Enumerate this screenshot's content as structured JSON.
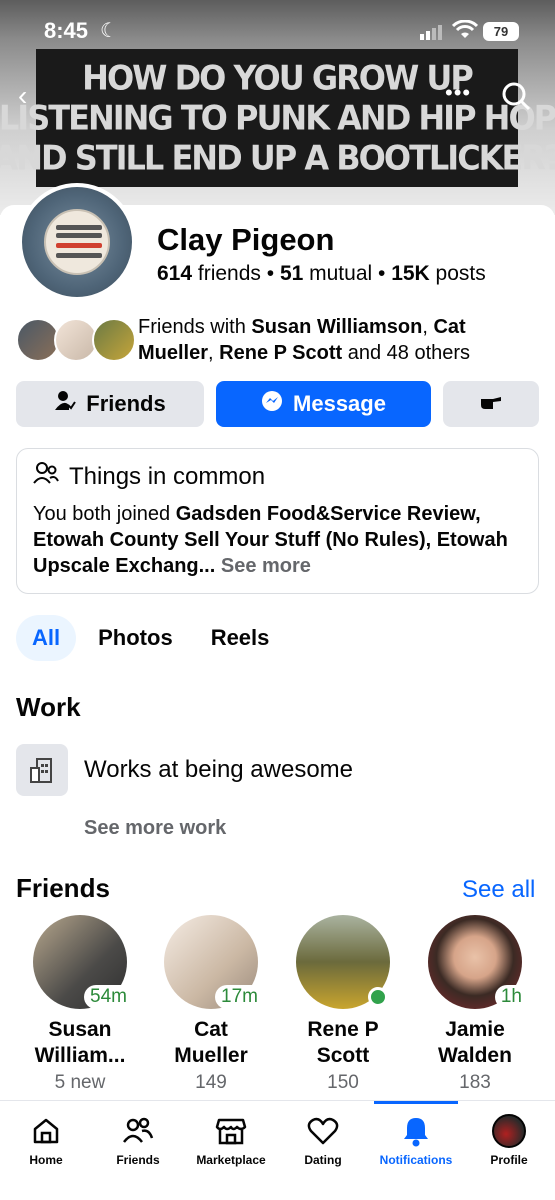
{
  "status_bar": {
    "time": "8:45",
    "battery": "79"
  },
  "cover": {
    "lines": [
      "HOW DO YOU GROW UP",
      "LISTENING TO PUNK AND HIP HOP",
      "AND STILL END UP A BOOTLICKER?"
    ]
  },
  "profile": {
    "name": "Clay Pigeon",
    "friends_count": "614",
    "friends_word": " friends • ",
    "mutual_count": "51",
    "mutual_word": " mutual • ",
    "posts_count": "15K",
    "posts_word": " posts"
  },
  "mutual": {
    "prefix": "Friends with ",
    "name1": "Susan Williamson",
    "sep1": ", ",
    "name2": "Cat Mueller",
    "sep2": ", ",
    "name3": "Rene P Scott",
    "suffix": " and 48 others"
  },
  "actions": {
    "friends": "Friends",
    "message": "Message"
  },
  "common": {
    "title": "Things in common",
    "prefix": "You both joined ",
    "groups": "Gadsden Food&Service Review, Etowah County Sell Your Stuff (No Rules), Etowah Upscale Exchang...",
    "see_more": "See more"
  },
  "tabs": [
    "All",
    "Photos",
    "Reels"
  ],
  "work": {
    "heading": "Work",
    "item": "Works at being awesome",
    "see_more": "See more work"
  },
  "friends": {
    "heading": "Friends",
    "see_all": "See all",
    "list": [
      {
        "name1": "Susan",
        "name2": "William...",
        "count": "5 new",
        "badge": "54m"
      },
      {
        "name1": "Cat",
        "name2": "Mueller",
        "count": "149",
        "badge": "17m"
      },
      {
        "name1": "Rene P",
        "name2": "Scott",
        "count": "150",
        "badge": ""
      },
      {
        "name1": "Jamie",
        "name2": "Walden",
        "count": "183",
        "badge": "1h"
      }
    ]
  },
  "tabbar": [
    "Home",
    "Friends",
    "Marketplace",
    "Dating",
    "Notifications",
    "Profile"
  ],
  "colors": {
    "accent": "#0866ff",
    "online": "#31a24c",
    "secondary_text": "#65676b"
  }
}
